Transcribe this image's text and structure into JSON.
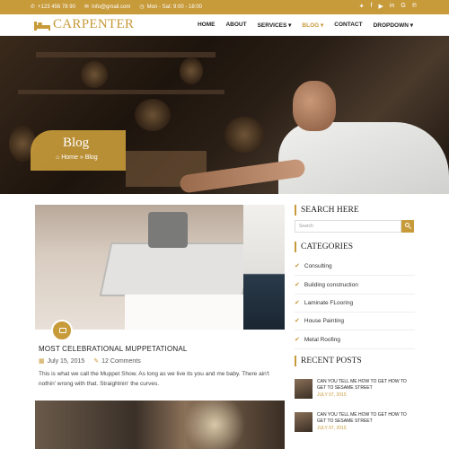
{
  "topbar": {
    "phone": "+123 456 78 90",
    "email": "Info@gmail.com",
    "hours": "Mon - Sat: 9:00 - 18:00",
    "social": [
      "twitter-icon",
      "facebook-icon",
      "youtube-icon",
      "linkedin-icon",
      "google-icon",
      "pinterest-icon"
    ]
  },
  "header": {
    "logo_text": "CARPENTER",
    "nav": [
      {
        "label": "HOME"
      },
      {
        "label": "ABOUT"
      },
      {
        "label": "SERVICES ▾"
      },
      {
        "label": "BLOG ▾"
      },
      {
        "label": "CONTACT"
      },
      {
        "label": "DROPDOWN ▾"
      }
    ]
  },
  "hero": {
    "title": "Blog",
    "breadcrumb_home": "Home",
    "breadcrumb_current": "Blog"
  },
  "post": {
    "title": "MOST CELEBRATIONAL MUPPETATIONAL",
    "date": "July 15, 2015",
    "comments": "12 Comments",
    "excerpt": "This is what we call the Muppet Show. As long as we live its you and me baby. There ain't nothin' wrong with that. Straightnin' the curves."
  },
  "sidebar": {
    "search_heading": "SEARCH HERE",
    "search_placeholder": "Search",
    "categories_heading": "CATEGORIES",
    "categories": [
      "Consulting",
      "Building construction",
      "Laminate FLooring",
      "House Painting",
      "Metal Roofing"
    ],
    "recent_heading": "RECENT POSTS",
    "recent": [
      {
        "title": "CAN YOU TELL ME HOW TO GET HOW TO GET TO SESAME STREET",
        "date": "JULY 07, 2015"
      },
      {
        "title": "CAN YOU TELL ME HOW TO GET HOW TO GET TO SESAME STREET",
        "date": "JULY 07, 2015"
      }
    ]
  },
  "colors": {
    "accent": "#c79a3a"
  }
}
